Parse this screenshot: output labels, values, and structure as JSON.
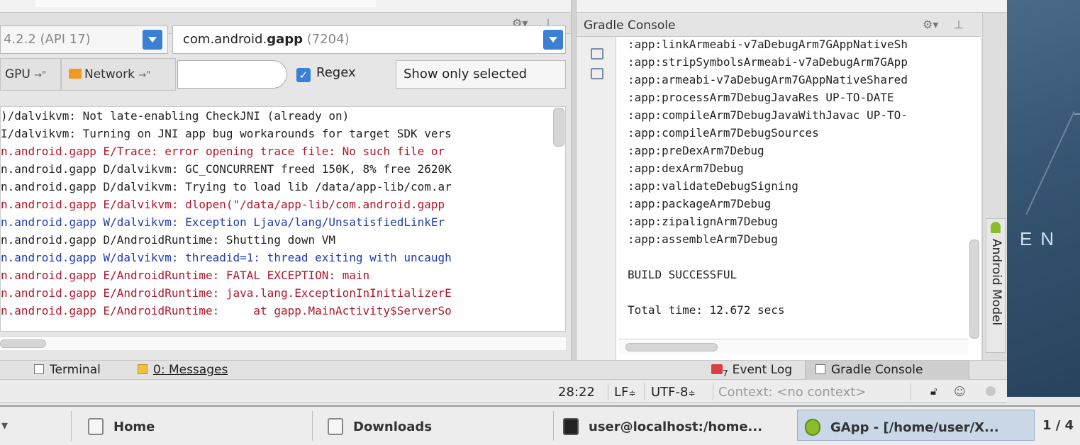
{
  "logcat": {
    "device": "4.2.2 (API 17)",
    "process_prefix": "com.android.",
    "process_bold": "gapp",
    "process_pid": "(7204)",
    "tab_gpu": "GPU",
    "tab_network": "Network",
    "search_value": "",
    "regex_label": "Regex",
    "regex_checked": true,
    "filter_option": "Show only selected",
    "lines": [
      {
        "text": ")/dalvikvm: Not late-enabling CheckJNI (already on)",
        "level": "I"
      },
      {
        "text": "I/dalvikvm: Turning on JNI app bug workarounds for target SDK vers",
        "level": "I"
      },
      {
        "text": "n.android.gapp E/Trace: error opening trace file: No such file or",
        "level": "E"
      },
      {
        "text": "n.android.gapp D/dalvikvm: GC_CONCURRENT freed 150K, 8% free 2620K",
        "level": "I"
      },
      {
        "text": "n.android.gapp D/dalvikvm: Trying to load lib /data/app-lib/com.ar",
        "level": "I"
      },
      {
        "text": "n.android.gapp E/dalvikvm: dlopen(\"/data/app-lib/com.android.gapp",
        "level": "E"
      },
      {
        "text": "n.android.gapp W/dalvikvm: Exception Ljava/lang/UnsatisfiedLinkEr",
        "level": "W"
      },
      {
        "text": "n.android.gapp D/AndroidRuntime: Shutting down VM",
        "level": "I"
      },
      {
        "text": "n.android.gapp W/dalvikvm: threadid=1: thread exiting with uncaugh",
        "level": "W"
      },
      {
        "text": "n.android.gapp E/AndroidRuntime: FATAL EXCEPTION: main",
        "level": "E"
      },
      {
        "text": "n.android.gapp E/AndroidRuntime: java.lang.ExceptionInInitializerE",
        "level": "E"
      },
      {
        "text": "n.android.gapp E/AndroidRuntime:     at gapp.MainActivity$ServerSo",
        "level": "E"
      }
    ]
  },
  "gradle": {
    "title": "Gradle Console",
    "lines": [
      ":app:linkArmeabi-v7aDebugArm7GAppNativeSh",
      ":app:stripSymbolsArmeabi-v7aDebugArm7GApp",
      ":app:armeabi-v7aDebugArm7GAppNativeShared",
      ":app:processArm7DebugJavaRes UP-TO-DATE",
      ":app:compileArm7DebugJavaWithJavac UP-TO-",
      ":app:compileArm7DebugSources",
      ":app:preDexArm7Debug",
      ":app:dexArm7Debug",
      ":app:validateDebugSigning",
      ":app:packageArm7Debug",
      ":app:zipalignArm7Debug",
      ":app:assembleArm7Debug",
      "",
      "BUILD SUCCESSFUL",
      "",
      "Total time: 12.672 secs"
    ]
  },
  "side_tab": "Android Model",
  "toolwindows": {
    "terminal": "Terminal",
    "messages": "0: Messages",
    "event_log": "Event Log",
    "event_count": "7",
    "gradle_console": "Gradle Console"
  },
  "status": {
    "position": "28:22",
    "line_sep": "LF",
    "encoding": "UTF-8",
    "context": "Context: <no context>"
  },
  "taskbar": {
    "home": "Home",
    "downloads": "Downloads",
    "terminal": "user@localhost:/home...",
    "gapp": "GApp - [/home/user/X...",
    "workspace": "1 / 4"
  },
  "desktop_text": "EN",
  "colors": {
    "error": "#b0162b",
    "warning": "#1f3bb0",
    "accent": "#3c80d6"
  }
}
